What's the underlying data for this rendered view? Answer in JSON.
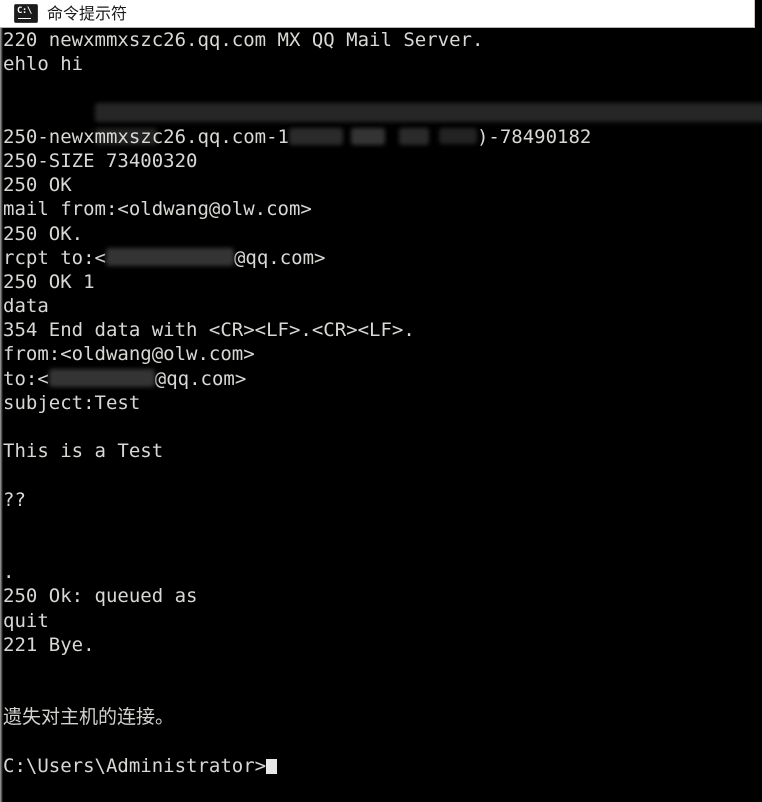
{
  "window": {
    "title": "命令提示符",
    "icon": "cmd-console-icon",
    "background_color": "#000000",
    "titlebar_color": "#ffffff",
    "text_color": "#d8d8d4"
  },
  "console": {
    "prompt": "C:\\Users\\Administrator>",
    "cursor": "block",
    "lines": [
      {
        "id": "l01",
        "text": "220 newxmmxszc26.qq.com MX QQ Mail Server."
      },
      {
        "id": "l02",
        "text": "ehlo hi"
      },
      {
        "id": "l03",
        "text": "",
        "redacted": "full-width-banner"
      },
      {
        "id": "l04",
        "text": "",
        "redacted": "short-block"
      },
      {
        "id": "l05",
        "prefix": "250-newxmmxszc26.qq.com-1",
        "redacted": "inline-blocks",
        "suffix": ")-78490182"
      },
      {
        "id": "l06",
        "text": "250-SIZE 73400320"
      },
      {
        "id": "l07",
        "text": "250 OK"
      },
      {
        "id": "l08",
        "text": "mail from:<oldwang@olw.com>"
      },
      {
        "id": "l09",
        "text": "250 OK."
      },
      {
        "id": "l10",
        "prefix": "rcpt to:<",
        "redacted": "inline-address",
        "suffix": "@qq.com>"
      },
      {
        "id": "l11",
        "text": "250 OK 1"
      },
      {
        "id": "l12",
        "text": "data"
      },
      {
        "id": "l13",
        "text": "354 End data with <CR><LF>.<CR><LF>."
      },
      {
        "id": "l14",
        "text": "from:<oldwang@olw.com>"
      },
      {
        "id": "l15",
        "prefix": "to:<",
        "redacted": "inline-address",
        "suffix": "@qq.com>"
      },
      {
        "id": "l16",
        "text": "subject:Test"
      },
      {
        "id": "l17",
        "text": ""
      },
      {
        "id": "l18",
        "text": "This is a Test"
      },
      {
        "id": "l19",
        "text": ""
      },
      {
        "id": "l20",
        "text": "??"
      },
      {
        "id": "l21",
        "text": ""
      },
      {
        "id": "l22",
        "text": ""
      },
      {
        "id": "l23",
        "text": "."
      },
      {
        "id": "l24",
        "text": "250 Ok: queued as"
      },
      {
        "id": "l25",
        "text": "quit"
      },
      {
        "id": "l26",
        "text": "221 Bye."
      },
      {
        "id": "l27",
        "text": ""
      },
      {
        "id": "l28",
        "text": ""
      },
      {
        "id": "l29",
        "text": "遗失对主机的连接。",
        "cjk": true
      },
      {
        "id": "l30",
        "text": ""
      },
      {
        "id": "l31",
        "text": "C:\\Users\\Administrator>",
        "cursor": true
      }
    ]
  }
}
